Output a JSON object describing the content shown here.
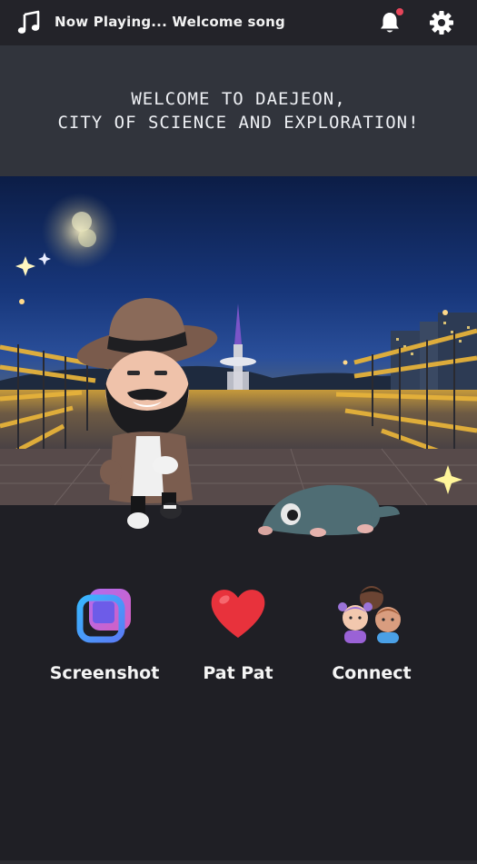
{
  "header": {
    "now_playing": "Now Playing... Welcome song",
    "has_notification": true
  },
  "banner": {
    "line1": "WELCOME TO DAEJEON,",
    "line2": "CITY OF SCIENCE AND EXPLORATION!"
  },
  "actions": [
    {
      "label": "Screenshot",
      "icon": "screenshot-icon"
    },
    {
      "label": "Pat Pat",
      "icon": "heart-icon"
    },
    {
      "label": "Connect",
      "icon": "friends-group-icon"
    }
  ],
  "colors": {
    "background": "#1f1f25",
    "banner": "#31343c",
    "notification_dot": "#e6455a",
    "heart": "#e8323c"
  }
}
